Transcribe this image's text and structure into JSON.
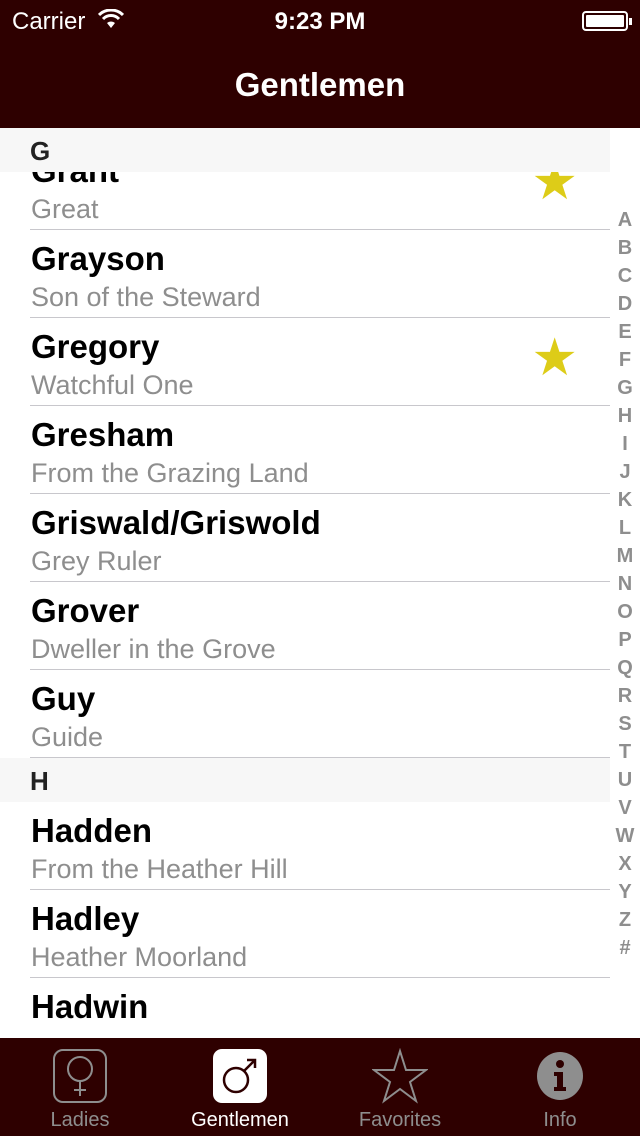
{
  "status": {
    "carrier": "Carrier",
    "time": "9:23 PM"
  },
  "nav": {
    "title": "Gentlemen"
  },
  "sections": [
    {
      "letter": "G",
      "rows": [
        {
          "name": "Grant",
          "meaning": "Great",
          "favorite": true
        },
        {
          "name": "Grayson",
          "meaning": "Son of the Steward",
          "favorite": false
        },
        {
          "name": "Gregory",
          "meaning": "Watchful One",
          "favorite": true
        },
        {
          "name": "Gresham",
          "meaning": "From the Grazing Land",
          "favorite": false
        },
        {
          "name": "Griswald/Griswold",
          "meaning": "Grey Ruler",
          "favorite": false
        },
        {
          "name": "Grover",
          "meaning": "Dweller in the Grove",
          "favorite": false
        },
        {
          "name": "Guy",
          "meaning": "Guide",
          "favorite": false
        }
      ]
    },
    {
      "letter": "H",
      "rows": [
        {
          "name": "Hadden",
          "meaning": "From the Heather Hill",
          "favorite": false
        },
        {
          "name": "Hadley",
          "meaning": "Heather Moorland",
          "favorite": false
        },
        {
          "name": "Hadwin",
          "meaning": "",
          "favorite": false
        }
      ]
    }
  ],
  "index": [
    "A",
    "B",
    "C",
    "D",
    "E",
    "F",
    "G",
    "H",
    "I",
    "J",
    "K",
    "L",
    "M",
    "N",
    "O",
    "P",
    "Q",
    "R",
    "S",
    "T",
    "U",
    "V",
    "W",
    "X",
    "Y",
    "Z",
    "#"
  ],
  "tabs": [
    {
      "label": "Ladies",
      "icon": "female-symbol-icon",
      "active": false
    },
    {
      "label": "Gentlemen",
      "icon": "male-symbol-icon",
      "active": true
    },
    {
      "label": "Favorites",
      "icon": "star-icon",
      "active": false
    },
    {
      "label": "Info",
      "icon": "info-icon",
      "active": false
    }
  ],
  "colors": {
    "bar": "#2e0000",
    "favorite_star": "#ddcc18",
    "secondary_text": "#8e8e8e"
  }
}
